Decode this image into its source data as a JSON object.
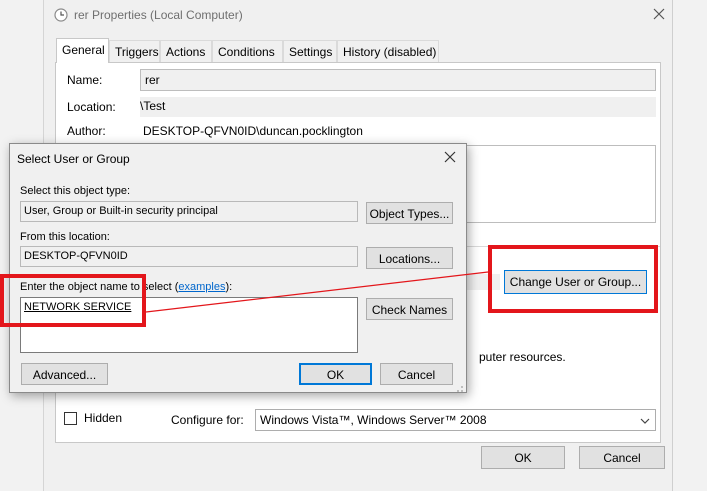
{
  "properties_window": {
    "title": "rer Properties (Local Computer)",
    "tabs": [
      "General",
      "Triggers",
      "Actions",
      "Conditions",
      "Settings",
      "History (disabled)"
    ],
    "name_label": "Name:",
    "name_value": "rer",
    "location_label": "Location:",
    "location_value": "\\Test",
    "author_label": "Author:",
    "author_value": "DESKTOP-QFVN0ID\\duncan.pocklington",
    "change_user_button": "Change User or Group...",
    "resources_text": "puter resources.",
    "hidden_label": "Hidden",
    "configure_label": "Configure for:",
    "configure_value": "Windows Vista™, Windows Server™ 2008",
    "ok_button": "OK",
    "cancel_button": "Cancel"
  },
  "select_dialog": {
    "title": "Select User or Group",
    "object_type_label": "Select this object type:",
    "object_type_value": "User, Group or Built-in security principal",
    "object_types_button": "Object Types...",
    "location_label": "From this location:",
    "location_value": "DESKTOP-QFVN0ID",
    "locations_button": "Locations...",
    "enter_label_prefix": "Enter the object name to select (",
    "examples_link": "examples",
    "enter_label_suffix": "):",
    "object_name_value": "NETWORK SERVICE",
    "check_names_button": "Check Names",
    "advanced_button": "Advanced...",
    "ok_button": "OK",
    "cancel_button": "Cancel"
  },
  "colors": {
    "highlight_red": "#e3161b",
    "focus_blue": "#0078d7",
    "link_blue": "#0066cc"
  },
  "icons": [
    "task-clock-icon",
    "close-icon",
    "dropdown-chevron-icon",
    "resize-grip-icon"
  ]
}
